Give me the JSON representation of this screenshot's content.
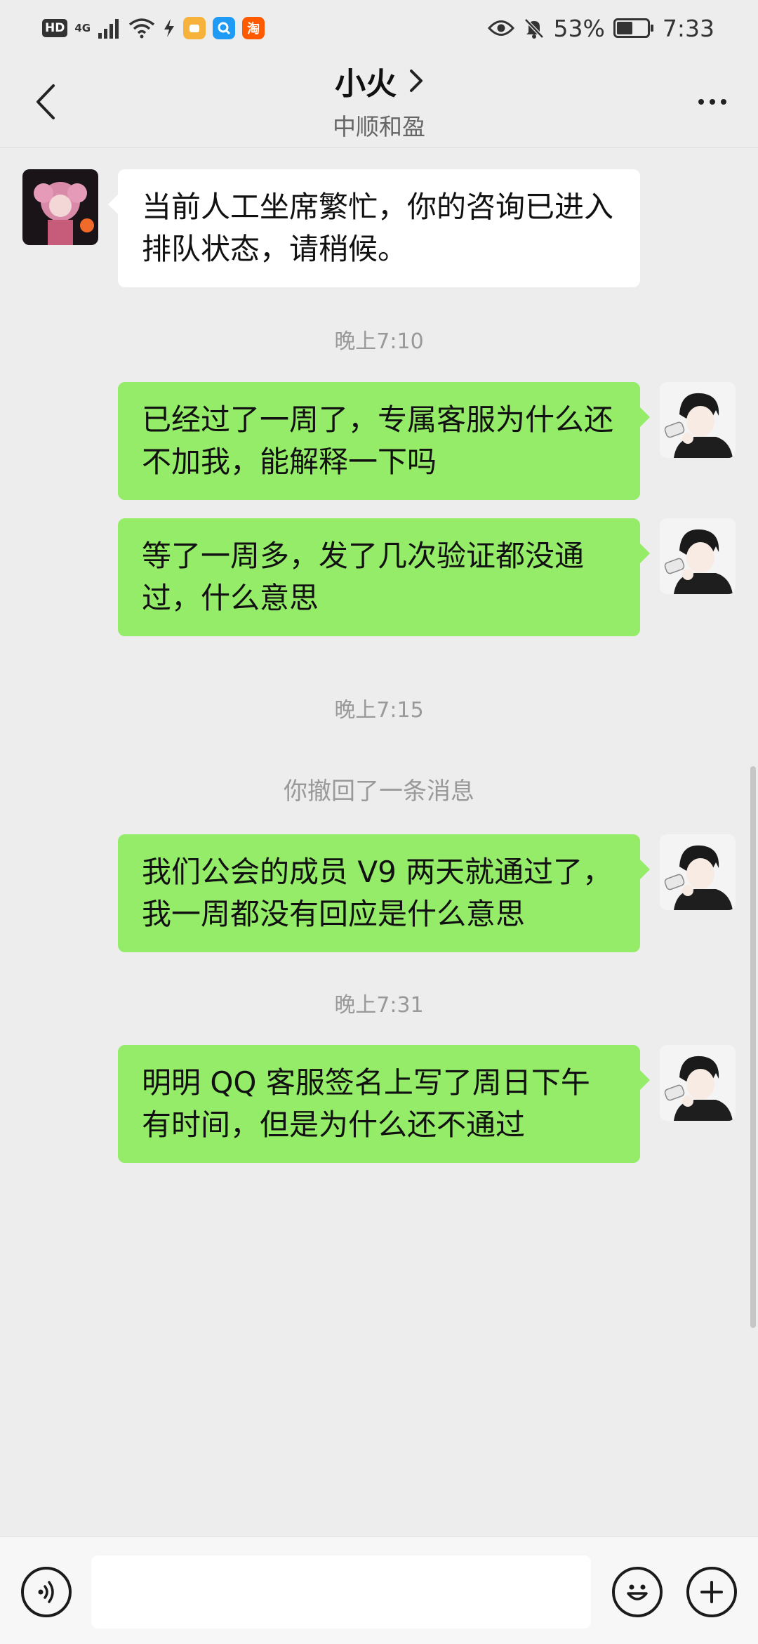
{
  "status_bar": {
    "hd": "HD",
    "network": "4G",
    "app_icon_taobao": "淘",
    "battery_percent": "53%",
    "battery_level": 0.53,
    "time": "7:33"
  },
  "header": {
    "title": "小火",
    "subtitle": "中顺和盈"
  },
  "messages": [
    {
      "type": "incoming",
      "text": "当前人工坐席繁忙，你的咨询已进入排队状态，请稍候。"
    },
    {
      "type": "time",
      "text": "晚上7:10"
    },
    {
      "type": "outgoing",
      "text": "已经过了一周了，专属客服为什么还不加我，能解释一下吗"
    },
    {
      "type": "outgoing",
      "text": "等了一周多，发了几次验证都没通过，什么意思"
    },
    {
      "type": "time",
      "text": "晚上7:15"
    },
    {
      "type": "system",
      "text": "你撤回了一条消息"
    },
    {
      "type": "outgoing",
      "text": "我们公会的成员 V9 两天就通过了，我一周都没有回应是什么意思"
    },
    {
      "type": "time",
      "text": "晚上7:31"
    },
    {
      "type": "outgoing",
      "text": "明明 QQ 客服签名上写了周日下午有时间，但是为什么还不通过"
    }
  ],
  "input": {
    "placeholder": "",
    "value": ""
  },
  "colors": {
    "outgoing_bubble": "#95ec69",
    "incoming_bubble": "#ffffff",
    "background": "#ededed"
  }
}
